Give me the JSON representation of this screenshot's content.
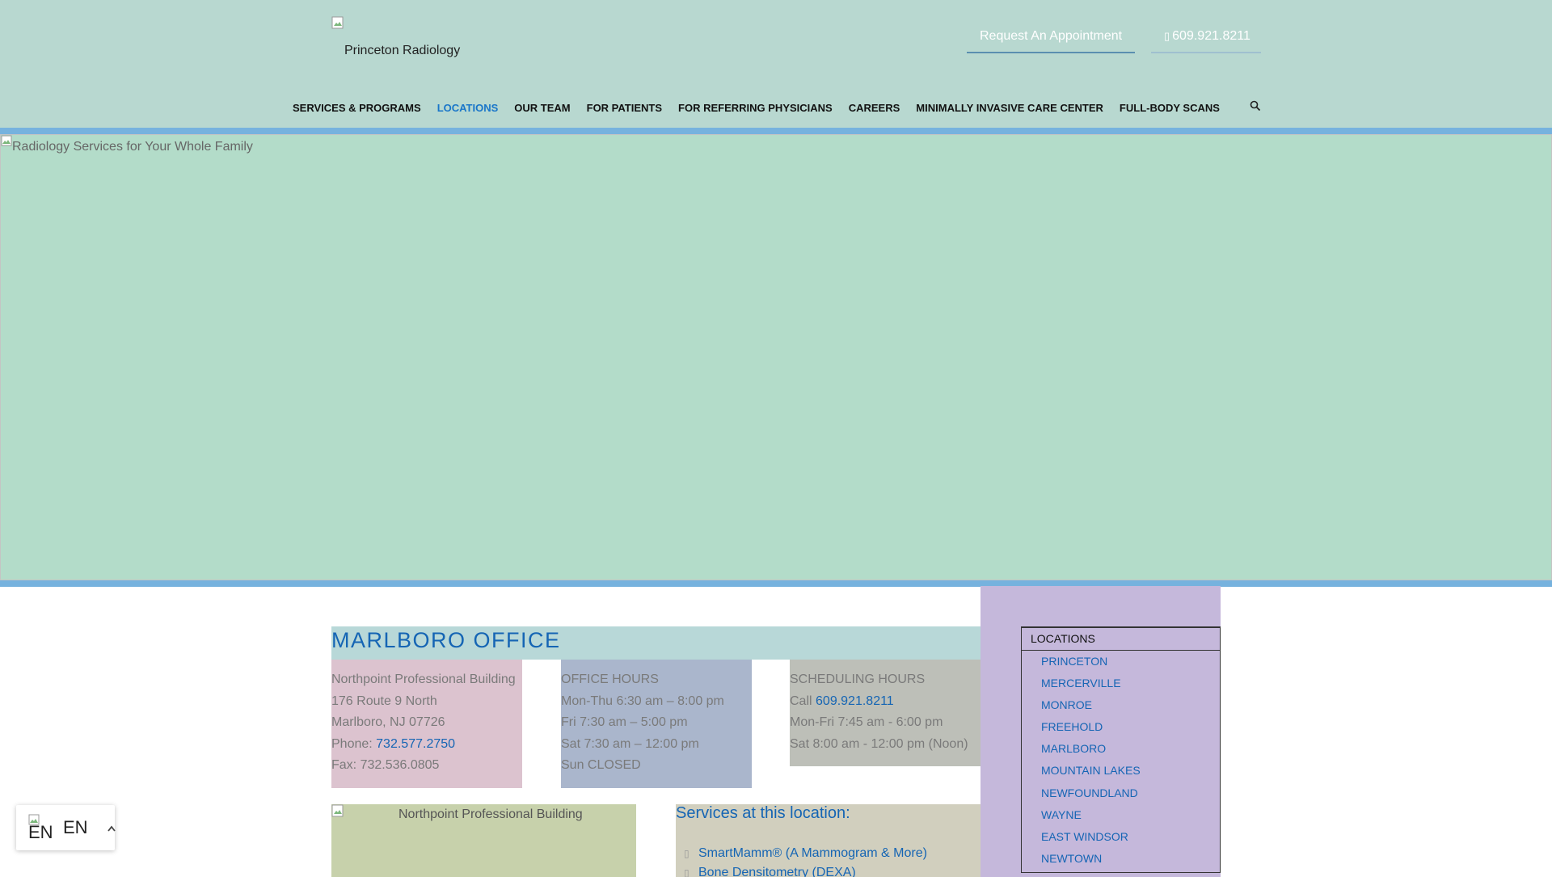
{
  "header": {
    "logo_alt": "Princeton Radiology",
    "request_appointment": "Request An Appointment",
    "phone": "609.921.8211",
    "nav": [
      {
        "label": "SERVICES & PROGRAMS"
      },
      {
        "label": "LOCATIONS",
        "active": true
      },
      {
        "label": "OUR TEAM"
      },
      {
        "label": "FOR PATIENTS"
      },
      {
        "label": "FOR REFERRING PHYSICIANS"
      },
      {
        "label": "CAREERS"
      },
      {
        "label": "MINIMALLY INVASIVE CARE CENTER"
      },
      {
        "label": "FULL-BODY SCANS"
      }
    ],
    "search_icon": "search-icon"
  },
  "hero": {
    "alt": "Radiology Services for Your Whole Family"
  },
  "office": {
    "title": "MARLBORO OFFICE",
    "address": {
      "building": "Northpoint Professional Building",
      "street": "176 Route 9 North",
      "city": "Marlboro, NJ 07726",
      "phone_label": "Phone: ",
      "phone": "732.577.2750",
      "fax": "Fax: 732.536.0805"
    },
    "office_hours": {
      "title": "OFFICE HOURS",
      "lines": [
        "Mon-Thu 6:30 am – 8:00 pm",
        "Fri 7:30 am – 5:00 pm",
        "Sat 7:30 am – 12:00 pm",
        "Sun CLOSED"
      ]
    },
    "scheduling_hours": {
      "title": "SCHEDULING HOURS",
      "call_label": "Call ",
      "phone": "609.921.8211",
      "lines": [
        "Mon-Fri 7:45 am - 6:00 pm",
        "Sat 8:00 am - 12:00 pm (Noon)"
      ]
    },
    "building_image_alt": "Northpoint Professional Building",
    "services": {
      "heading": "Services at this location:",
      "items": [
        "SmartMamm® (A Mammogram & More)",
        "Bone Densitometry (DEXA)"
      ]
    }
  },
  "sidebar": {
    "header": "LOCATIONS",
    "locations": [
      "PRINCETON",
      "MERCERVILLE",
      "MONROE",
      "FREEHOLD",
      "MARLBORO",
      "MOUNTAIN LAKES",
      "NEWFOUNDLAND",
      "WAYNE",
      "EAST WINDSOR",
      "NEWTOWN"
    ]
  },
  "language": {
    "flag_label": "EN",
    "code": "EN"
  },
  "colors": {
    "header_bg": "#b8d8d0",
    "accent_blue": "#1565b4",
    "nav_active": "#1976c9",
    "hero_bar": "#76b2de",
    "hero_bg": "#b3dcc9",
    "sidebar_bg": "#c5b8db"
  }
}
